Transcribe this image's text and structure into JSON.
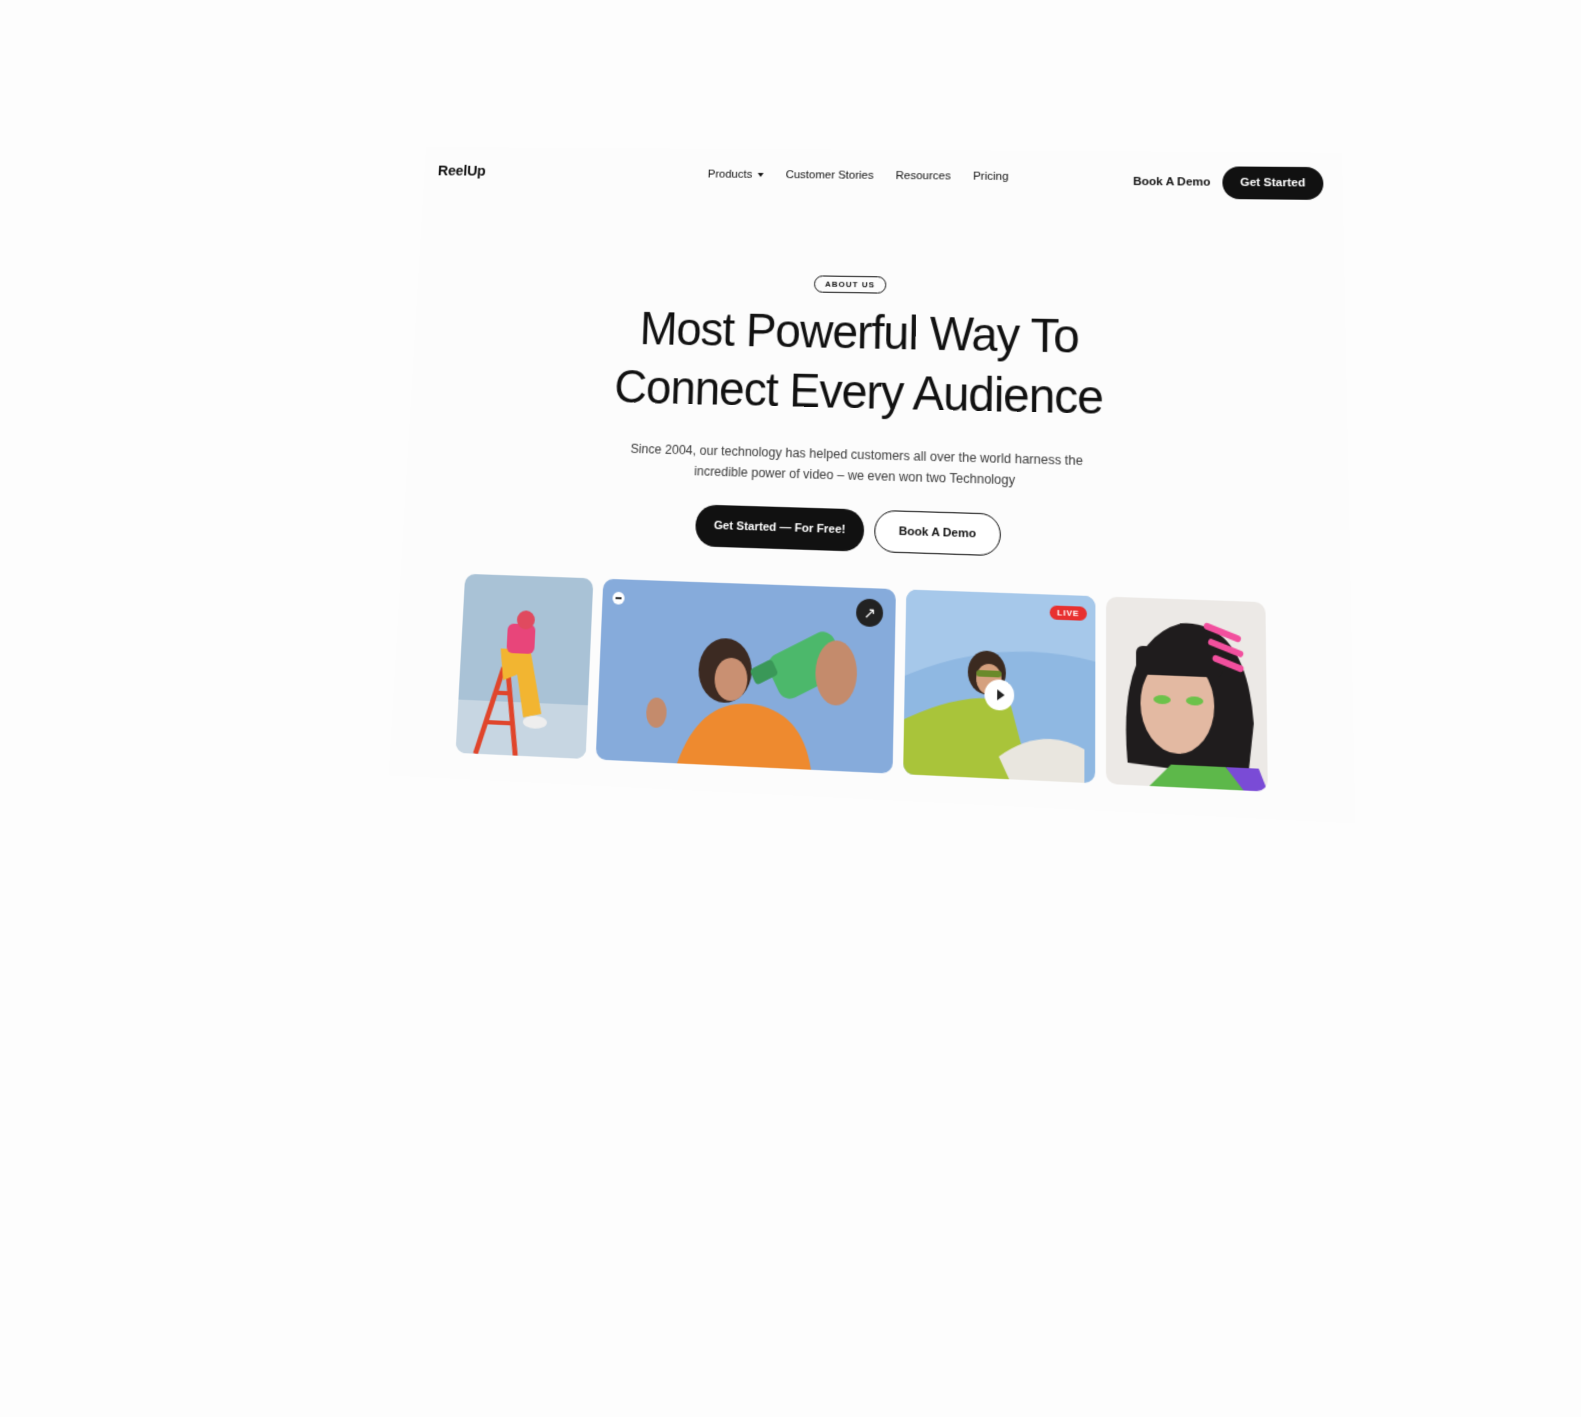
{
  "header": {
    "logo": "ReelUp",
    "nav": [
      {
        "label": "Products",
        "has_dropdown": true
      },
      {
        "label": "Customer Stories"
      },
      {
        "label": "Resources"
      },
      {
        "label": "Pricing"
      }
    ],
    "demo_label": "Book A Demo",
    "cta_label": "Get Started"
  },
  "hero": {
    "badge": "ABOUT US",
    "headline_line1": "Most Powerful Way To",
    "headline_line2": "Connect Every Audience",
    "subtext": "Since 2004, our technology has helped customers all over the world harness the incredible power of video – we even won two Technology",
    "primary_cta": "Get Started — For Free!",
    "secondary_cta": "Book A Demo"
  },
  "cards": [
    {
      "image": "person-on-red-ladder-photo"
    },
    {
      "image": "woman-holding-green-bottle-photo",
      "icons": [
        "brand-logo-icon",
        "arrow-up-right-icon"
      ]
    },
    {
      "image": "person-in-green-sweater-photo",
      "badge": "LIVE",
      "icons": [
        "play-icon"
      ]
    },
    {
      "image": "woman-with-pink-hair-clips-photo"
    }
  ],
  "colors": {
    "primary": "#111111",
    "background": "#fcfcfc",
    "live_badge": "#e8302f"
  }
}
